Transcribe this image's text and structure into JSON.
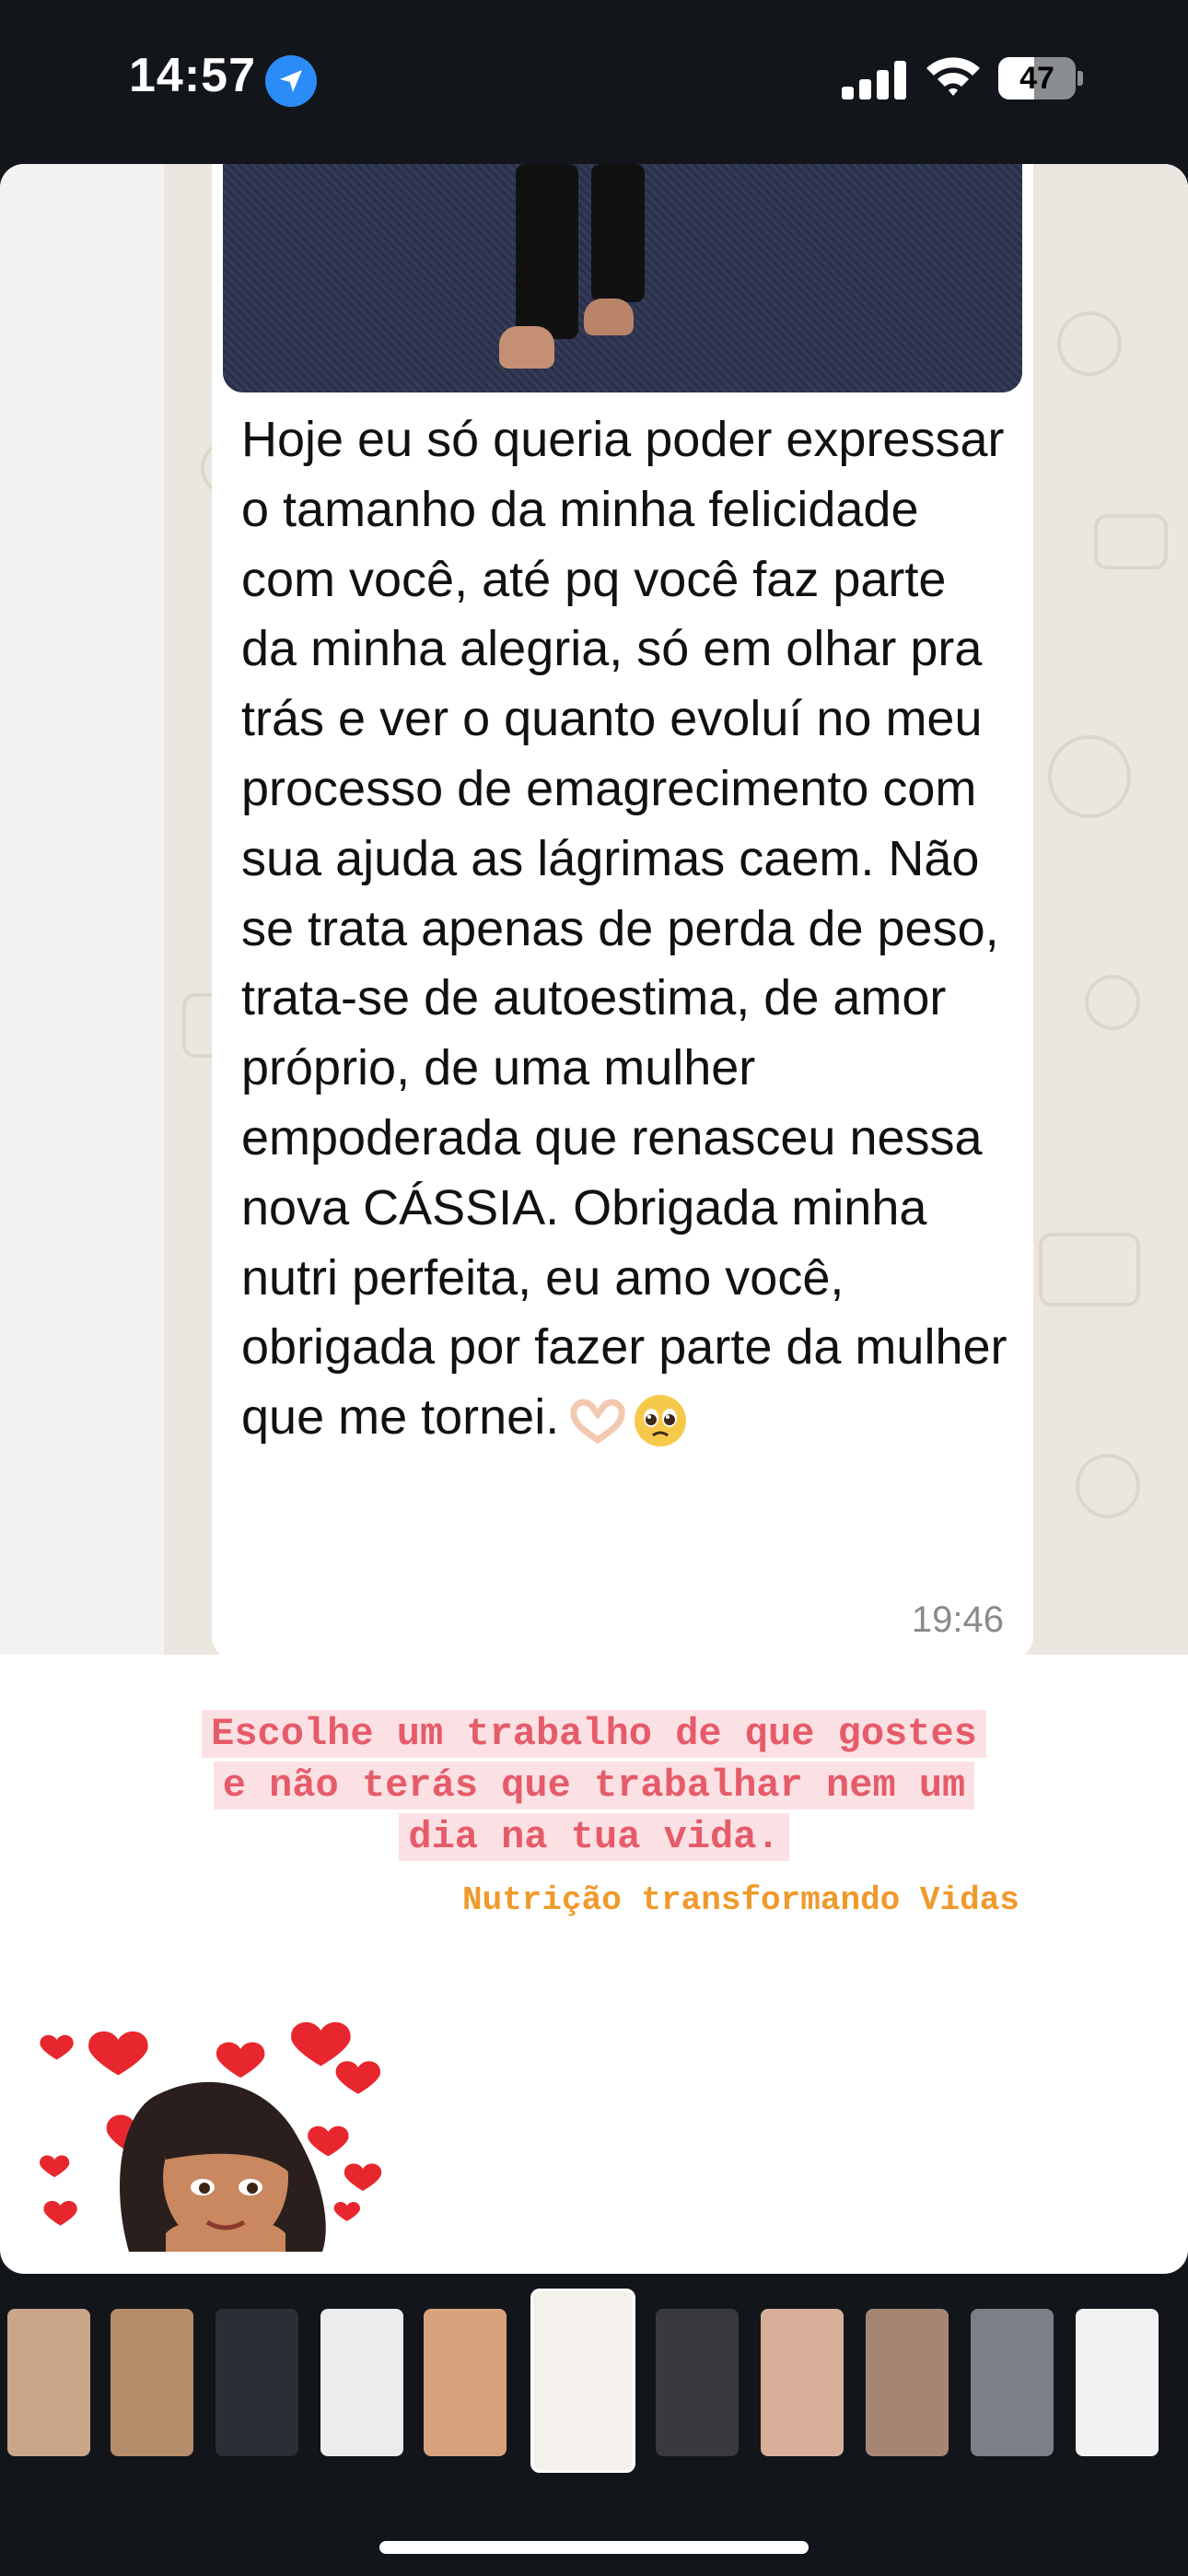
{
  "status_bar": {
    "time": "14:57",
    "battery_level": "47",
    "battery_fraction": 0.47,
    "icons": [
      "location-arrow-icon",
      "cellular-signal-icon",
      "wifi-icon",
      "battery-icon"
    ]
  },
  "chat": {
    "message": "Hoje eu só queria poder expressar o tamanho da minha felicidade com você, até pq você faz parte da minha alegria, só em olhar pra trás e ver o quanto evoluí no meu processo de emagrecimento com sua ajuda as lágrimas caem. Não se trata apenas de perda de peso, trata-se de autoestima, de amor próprio, de uma mulher empoderada que renasceu nessa nova CÁSSIA. Obrigada minha nutri perfeita, eu amo você, obrigada por fazer parte da mulher que me tornei.",
    "emojis": [
      "heart-hands-emoji",
      "pleading-face-emoji"
    ],
    "time": "19:46"
  },
  "story": {
    "quote_line1": "Escolhe um trabalho de que gostes",
    "quote_line2": "e não terás que trabalhar nem um",
    "quote_line3": "dia na tua vida.",
    "tagline": "Nutrição transformando Vidas",
    "sticker": "memoji-with-hearts-sticker"
  },
  "colors": {
    "quote_text": "#e65b6a",
    "quote_highlight": "#fbe1e3",
    "tagline": "#ef9a2b",
    "chat_wallpaper": "#ebe6df",
    "background": "#12161b"
  },
  "thumbnails": [
    {
      "name": "story-thumb-1",
      "color": "#c9a58a",
      "active": false
    },
    {
      "name": "story-thumb-2",
      "color": "#b58d6a",
      "active": false
    },
    {
      "name": "story-thumb-3",
      "color": "#2b2f35",
      "active": false
    },
    {
      "name": "story-thumb-4",
      "color": "#ececec",
      "active": false
    },
    {
      "name": "story-thumb-5",
      "color": "#d9a27e",
      "active": false
    },
    {
      "name": "story-thumb-6",
      "color": "#f4f1ec",
      "active": true
    },
    {
      "name": "story-thumb-7",
      "color": "#3a3a3e",
      "active": false
    },
    {
      "name": "story-thumb-8",
      "color": "#d8b09a",
      "active": false
    },
    {
      "name": "story-thumb-9",
      "color": "#a78574",
      "active": false
    },
    {
      "name": "story-thumb-10",
      "color": "#7d7f86",
      "active": false
    },
    {
      "name": "story-thumb-11",
      "color": "#f2f2f2",
      "active": false
    }
  ]
}
